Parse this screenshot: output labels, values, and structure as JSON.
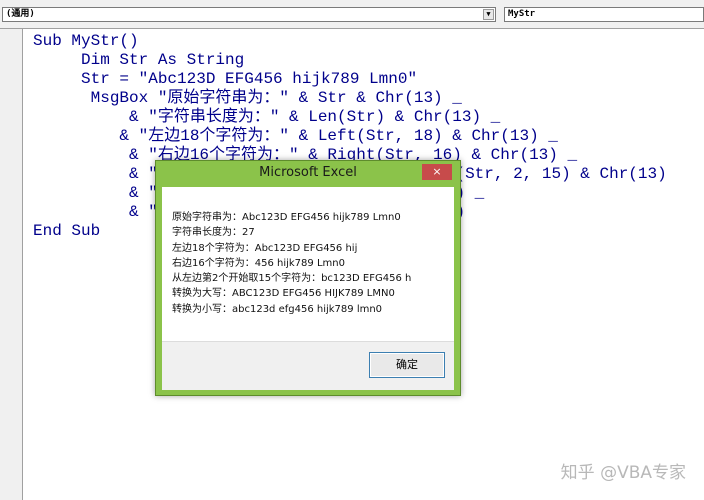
{
  "toolbar": {
    "object_combo": "(通用)",
    "procedure_combo": "MyStr"
  },
  "code_lines": [
    "Sub MyStr()",
    "     Dim Str As String",
    "     Str = \"Abc123D EFG456 hijk789 Lmn0\"",
    "      MsgBox \"原始字符串为：\" & Str & Chr(13) _",
    "          & \"字符串长度为：\" & Len(Str) & Chr(13) _",
    "         & \"左边18个字符为：\" & Left(Str, 18) & Chr(13) _",
    "          & \"右边16个字符为：\" & Right(Str, 16) & Chr(13) _",
    "          & \"                            Mid(Str, 2, 15) & Chr(13)",
    "          & \"                            (13) _",
    "          & \"                            (13)",
    "End Sub"
  ],
  "dialog": {
    "title": "Microsoft Excel",
    "close_glyph": "×",
    "message_lines": [
      "原始字符串为：Abc123D EFG456 hijk789 Lmn0",
      "字符串长度为：27",
      "左边18个字符为：Abc123D EFG456 hij",
      "右边16个字符为：456 hijk789 Lmn0",
      "从左边第2个开始取15个字符为：bc123D EFG456 h",
      "转换为大写：ABC123D EFG456 HIJK789 LMN0",
      "转换为小写：abc123d efg456 hijk789 lmn0"
    ],
    "ok_label": "确定"
  },
  "watermark": "知乎 @VBA专家",
  "icons": {
    "dropdown": "dropdown-arrow-icon",
    "close": "close-icon"
  },
  "colors": {
    "code_text": "#00008b",
    "dialog_frame": "#8bc34a",
    "close_button": "#c74b4b"
  }
}
